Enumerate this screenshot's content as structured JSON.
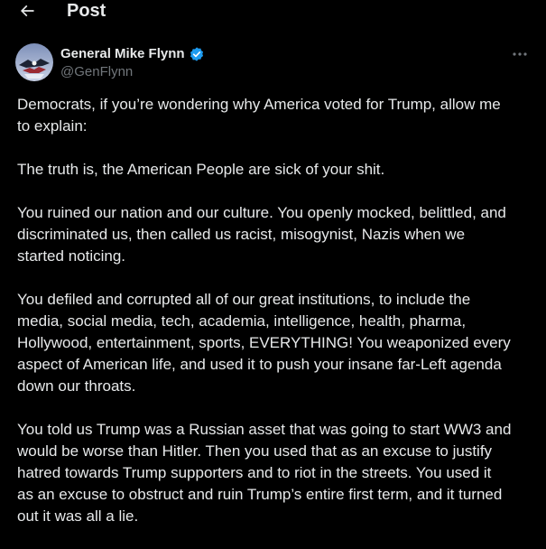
{
  "header": {
    "title": "Post",
    "back_icon": "arrow-left-icon"
  },
  "author": {
    "display_name": "General Mike Flynn",
    "handle": "@GenFlynn",
    "verified_badge_color": "#1d9bf0",
    "verified_icon": "verified-badge-icon"
  },
  "more_icon": "more-horizontal-icon",
  "tweet": {
    "paragraphs": [
      "Democrats, if you’re wondering why America voted for Trump, allow me\nto explain:",
      "The truth is, the American People are sick of your shit.",
      "You ruined our nation and our culture. You openly mocked, belittled, and\ndiscriminated us, then called us racist, misogynist, Nazis when we\nstarted noticing.",
      "You defiled and corrupted all of our great institutions, to include the\nmedia, social media, tech, academia, intelligence, health, pharma,\nHollywood, entertainment, sports, EVERYTHING! You weaponized every\naspect of American life, and used it to push your insane far-Left agenda\ndown our throats.",
      "You told us Trump was a Russian asset that was going to start WW3 and\nwould be worse than Hitler. Then you used that as an excuse to justify\nhatred towards Trump supporters and to riot in the streets. You used it\nas an excuse to obstruct and ruin Trump’s entire first term, and it turned\nout it was all a lie."
    ]
  },
  "colors": {
    "background": "#000000",
    "text_primary": "#e7e9ea",
    "text_secondary": "#71767b",
    "accent": "#1d9bf0"
  }
}
